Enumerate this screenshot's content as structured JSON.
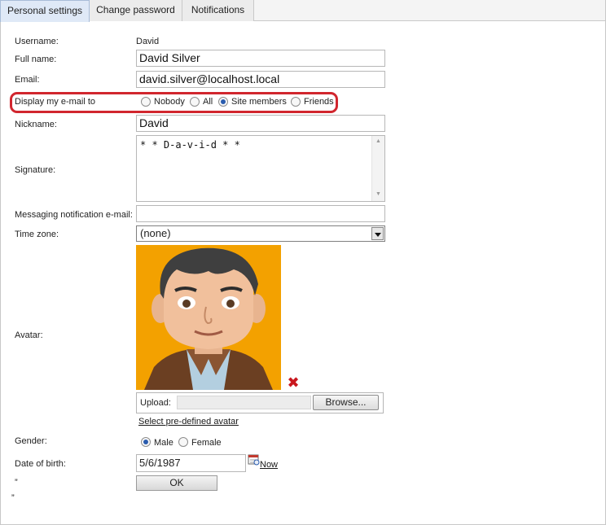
{
  "tabs": [
    {
      "label": "Personal settings",
      "active": true
    },
    {
      "label": "Change password",
      "active": false
    },
    {
      "label": "Notifications",
      "active": false
    }
  ],
  "form": {
    "username_label": "Username:",
    "username_value": "David",
    "fullname_label": "Full name:",
    "fullname_value": "David Silver",
    "email_label": "Email:",
    "email_value": "david.silver@localhost.local",
    "display_email_label": "Display my e-mail to",
    "display_email_options": [
      {
        "label": "Nobody",
        "checked": false
      },
      {
        "label": "All",
        "checked": false
      },
      {
        "label": "Site members",
        "checked": true
      },
      {
        "label": "Friends",
        "checked": false
      }
    ],
    "nickname_label": "Nickname:",
    "nickname_value": "David",
    "signature_label": "Signature:",
    "signature_value": "* * D-a-v-i-d * *",
    "messaging_label": "Messaging notification e-mail:",
    "messaging_value": "",
    "timezone_label": "Time zone:",
    "timezone_value": "(none)",
    "avatar_label": "Avatar:",
    "upload_label": "Upload:",
    "browse_label": "Browse...",
    "predefined_avatar_link": "Select pre-defined avatar",
    "gender_label": "Gender:",
    "gender_options": [
      {
        "label": "Male",
        "checked": true
      },
      {
        "label": "Female",
        "checked": false
      }
    ],
    "dob_label": "Date of birth:",
    "dob_value": "5/6/1987",
    "now_link": "Now",
    "ok_label": "OK",
    "stray_mark_1": "”",
    "stray_mark_2": "”"
  },
  "colors": {
    "highlight": "#d1262e",
    "avatar_bg": "#f3a100",
    "delete_icon": "#c9171e",
    "radio_checked": "#2a5cae"
  }
}
